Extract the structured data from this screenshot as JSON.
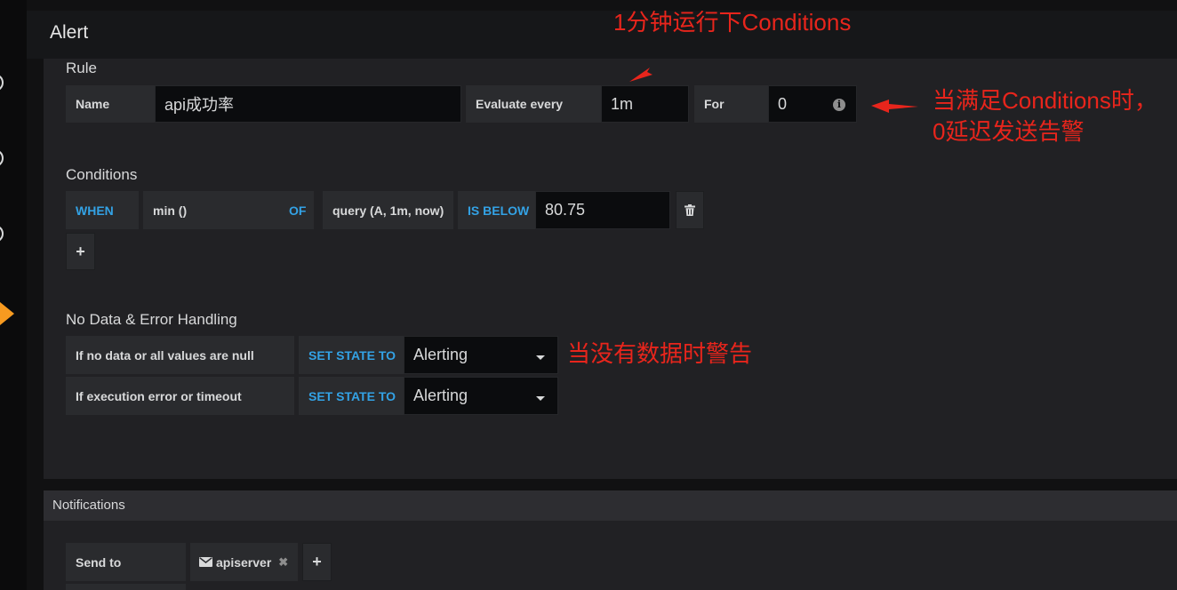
{
  "header": {
    "title": "Alert"
  },
  "rule": {
    "section_title": "Rule",
    "name_label": "Name",
    "name_value": "api成功率",
    "evaluate_label": "Evaluate every",
    "evaluate_value": "1m",
    "for_label": "For",
    "for_value": "0"
  },
  "conditions": {
    "section_title": "Conditions",
    "when": "WHEN",
    "reducer": "min ()",
    "of": "OF",
    "query": "query (A, 1m, now)",
    "evaluator": "IS BELOW",
    "threshold": "80.75",
    "add_label": "+"
  },
  "no_data": {
    "section_title": "No Data & Error Handling",
    "rows": [
      {
        "label": "If no data or all values are null",
        "action": "SET STATE TO",
        "value": "Alerting"
      },
      {
        "label": "If execution error or timeout",
        "action": "SET STATE TO",
        "value": "Alerting"
      }
    ]
  },
  "notifications": {
    "title": "Notifications",
    "send_to_label": "Send to",
    "channels": [
      "apiserver"
    ],
    "add_label": "+"
  },
  "annotations": {
    "top": "1分钟运行下Conditions",
    "right_line1": "当满足Conditions时，",
    "right_line2": "0延迟发送告警",
    "no_data_note": "当没有数据时警告"
  },
  "colors": {
    "accent_blue": "#33a2e5",
    "annotation_red": "#e8251c",
    "brand_orange": "#f79a20"
  },
  "icons": {
    "delete": "trash-icon",
    "info": "info-icon",
    "mail": "envelope-icon",
    "remove": "close-icon"
  }
}
